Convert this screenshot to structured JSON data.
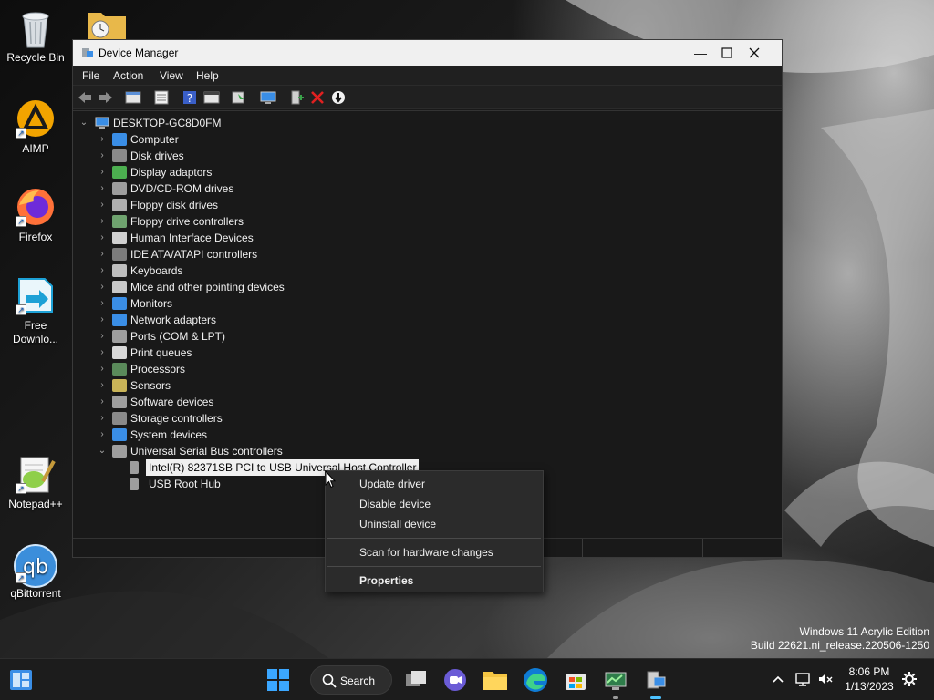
{
  "desktop": {
    "icons": [
      {
        "label": "Recycle Bin"
      },
      {
        "label": "AIMP"
      },
      {
        "label": "Firefox"
      },
      {
        "label": "Free Downlo..."
      },
      {
        "label": "Notepad++"
      },
      {
        "label": "qBittorrent"
      }
    ],
    "watermark": {
      "line1": "Windows 11 Acrylic Edition",
      "line2": "Build 22621.ni_release.220506-1250"
    }
  },
  "window": {
    "title": "Device Manager",
    "menu": [
      "File",
      "Action",
      "View",
      "Help"
    ],
    "toolbar": [
      "back-icon",
      "forward-icon",
      "properties-list-icon",
      "view-icon",
      "help-icon",
      "show-hidden-icon",
      "update-driver-icon",
      "monitor-scan-icon",
      "enable-device-icon",
      "uninstall-icon",
      "disable-device-icon"
    ],
    "tree": {
      "root": "DESKTOP-GC8D0FM",
      "categories": [
        {
          "label": "Computer",
          "color": "#3a8ee6"
        },
        {
          "label": "Disk drives",
          "color": "#8a8a8a"
        },
        {
          "label": "Display adaptors",
          "color": "#4caf50"
        },
        {
          "label": "DVD/CD-ROM drives",
          "color": "#9e9e9e"
        },
        {
          "label": "Floppy disk drives",
          "color": "#b0b0b0"
        },
        {
          "label": "Floppy drive controllers",
          "color": "#6fa36f"
        },
        {
          "label": "Human Interface Devices",
          "color": "#d0d0d0"
        },
        {
          "label": "IDE ATA/ATAPI controllers",
          "color": "#7c7c7c"
        },
        {
          "label": "Keyboards",
          "color": "#bdbdbd"
        },
        {
          "label": "Mice and other pointing devices",
          "color": "#c8c8c8"
        },
        {
          "label": "Monitors",
          "color": "#3a8ee6"
        },
        {
          "label": "Network adapters",
          "color": "#3a8ee6"
        },
        {
          "label": "Ports (COM & LPT)",
          "color": "#9e9e9e"
        },
        {
          "label": "Print queues",
          "color": "#d8d8d8"
        },
        {
          "label": "Processors",
          "color": "#5a8a5a"
        },
        {
          "label": "Sensors",
          "color": "#c9b458"
        },
        {
          "label": "Software devices",
          "color": "#9e9e9e"
        },
        {
          "label": "Storage controllers",
          "color": "#8a8a8a"
        },
        {
          "label": "System devices",
          "color": "#3a8ee6"
        },
        {
          "label": "Universal Serial Bus controllers",
          "color": "#9e9e9e"
        }
      ],
      "usb_children": [
        {
          "label": "Intel(R) 82371SB PCI to USB Universal Host Controller"
        },
        {
          "label": "USB Root Hub"
        }
      ]
    }
  },
  "context_menu": {
    "update": "Update driver",
    "disable": "Disable device",
    "uninstall": "Uninstall device",
    "scan": "Scan for hardware changes",
    "properties": "Properties"
  },
  "taskbar": {
    "search_label": "Search",
    "time": "8:06 PM",
    "date": "1/13/2023",
    "accent": "#4cc2ff"
  }
}
